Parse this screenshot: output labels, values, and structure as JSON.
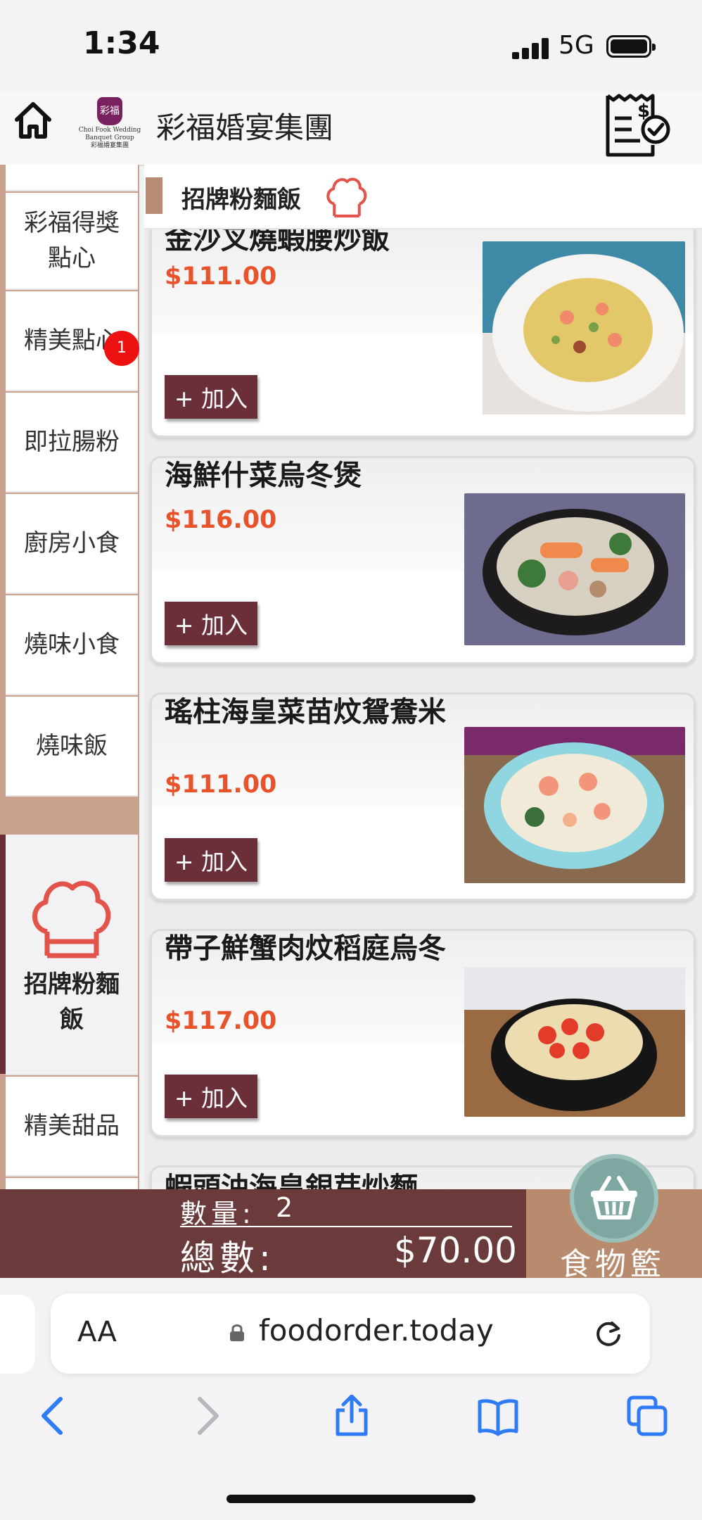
{
  "status_bar": {
    "time": "1:34",
    "network": "5G"
  },
  "header": {
    "brand_name": "彩福婚宴集團",
    "logo_badge": "彩福",
    "logo_text_en": "Choi Fook Wedding Banquet Group",
    "logo_text_cn": "彩福婚宴集團"
  },
  "sidebar": {
    "items": [
      {
        "label": "彩福得獎點心"
      },
      {
        "label": "精美點心",
        "badge": "1"
      },
      {
        "label": "即拉腸粉"
      },
      {
        "label": "廚房小食"
      },
      {
        "label": "燒味小食"
      },
      {
        "label": "燒味飯"
      },
      {
        "label": "招牌粉麵飯",
        "active": true
      },
      {
        "label": "精美甜品"
      }
    ]
  },
  "section": {
    "title": "招牌粉麵飯"
  },
  "menu": {
    "add_label": "+ 加入",
    "items": [
      {
        "name": "金沙叉燒蝦腰炒飯",
        "price": "$111.00"
      },
      {
        "name": "海鮮什菜烏冬煲",
        "price": "$116.00"
      },
      {
        "name": "瑤柱海皇菜苗炆鴛鴦米",
        "price": "$111.00"
      },
      {
        "name": "帶子鮮蟹肉炆稻庭烏冬",
        "price": "$117.00"
      },
      {
        "name": "蝦頭油海皇銀芽炒麵",
        "price": ""
      }
    ]
  },
  "cart": {
    "qty_label": "數量:",
    "qty_value": "2",
    "total_label": "總數:",
    "total_value": "$70.00",
    "basket_label": "食物籃"
  },
  "browser": {
    "aa": "AA",
    "url": "foodorder.today"
  },
  "colors": {
    "accent": "#6b2f3a",
    "price": "#e8532c",
    "sidebar_bg": "#c9a18c",
    "basket": "#b88a6e",
    "chef_icon": "#e2534a"
  }
}
